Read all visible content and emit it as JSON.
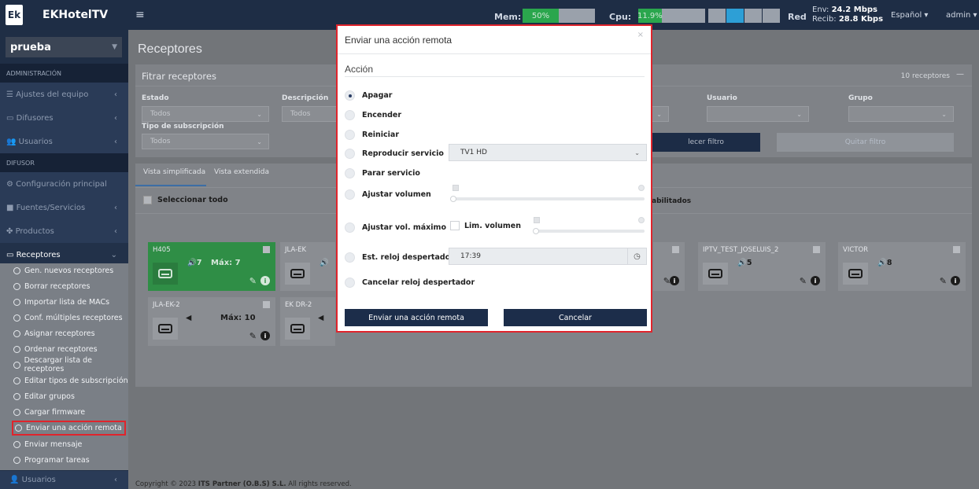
{
  "header": {
    "logo": "Ek",
    "app_name": "EKHotelTV",
    "menu_icon": "≡",
    "mem_label": "Mem:",
    "mem_value": "50%",
    "mem_fraction": 0.5,
    "cpu_label": "Cpu:",
    "cpu_value": "11.9%",
    "cpu_fraction": 0.119,
    "red_label": "Red",
    "env_label": "Env:",
    "env_value": "24.2 Mbps",
    "recib_label": "Recib:",
    "recib_value": "28.8 Kbps",
    "language": "Español ▾",
    "user": "admin ▾"
  },
  "sidebar": {
    "company": "prueba",
    "section_admin": "ADMINISTRACIÓN",
    "admin_items": [
      "Ajustes del equipo",
      "Difusores",
      "Usuarios"
    ],
    "section_difusor": "DIFUSOR",
    "difusor_items": [
      "Configuración principal",
      "Fuentes/Servicios",
      "Productos"
    ],
    "receptores": "Receptores",
    "sub_items": [
      "Gen. nuevos receptores",
      "Borrar receptores",
      "Importar lista de MACs",
      "Conf. múltiples receptores",
      "Asignar receptores",
      "Ordenar receptores",
      "Descargar lista de receptores",
      "Editar tipos de subscripción",
      "Editar grupos",
      "Cargar firmware",
      "Enviar una acción remota",
      "Enviar mensaje",
      "Programar tareas"
    ],
    "bottom": "Usuarios"
  },
  "page": {
    "title": "Receptores",
    "filter_title": "Fitrar receptores",
    "receiver_count": "10 receptores",
    "collapse": "—",
    "labels": {
      "estado": "Estado",
      "descripcion": "Descripción",
      "usuario": "Usuario",
      "grupo": "Grupo",
      "tipo": "Tipo de subscripción"
    },
    "estado_value": "Todos",
    "descripcion_value": "Todos",
    "tipo_value": "Todos",
    "apply_filter": "lecer filtro",
    "remove_filter": "Quitar filtro",
    "tab_simple": "Vista simplificada",
    "tab_extended": "Vista extendida",
    "select_all": "Seleccionar todo",
    "habilitados": "abilitados"
  },
  "cards": [
    {
      "name": "H405",
      "vol": "🔊7",
      "max": "Máx: 7"
    },
    {
      "name": "JLA-EK",
      "vol": "🔊",
      "max": ""
    },
    {
      "name": "IPTV_TEST_JOSELUIS_2",
      "vol": "🔊5",
      "max": ""
    },
    {
      "name": "VICTOR",
      "vol": "🔊8",
      "max": ""
    },
    {
      "name": "JLA-EK-2",
      "vol": "◀",
      "max": "Máx: 10"
    },
    {
      "name": "EK DR-2",
      "vol": "◀",
      "max": ""
    }
  ],
  "footer": {
    "prefix": "Copyright © 2023 ",
    "company": "ITS Partner (O.B.S) S.L.",
    "suffix": " All rights reserved."
  },
  "modal": {
    "title": "Enviar una acción remota",
    "close": "×",
    "section": "Acción",
    "options": [
      "Apagar",
      "Encender",
      "Reiniciar",
      "Reproducir servicio",
      "Parar servicio",
      "Ajustar volumen",
      "Ajustar vol. máximo",
      "Est. reloj despertador",
      "Cancelar reloj despertador"
    ],
    "service_value": "TV1 HD",
    "lim_label": "Lim. volumen",
    "alarm_time": "17:39",
    "submit": "Enviar una acción remota",
    "cancel": "Cancelar"
  },
  "colors": {
    "header_bg": "#1e2d45",
    "accent_green": "#2aa64d",
    "highlight_red": "#e0242c",
    "button_navy": "#1c2d4a"
  }
}
